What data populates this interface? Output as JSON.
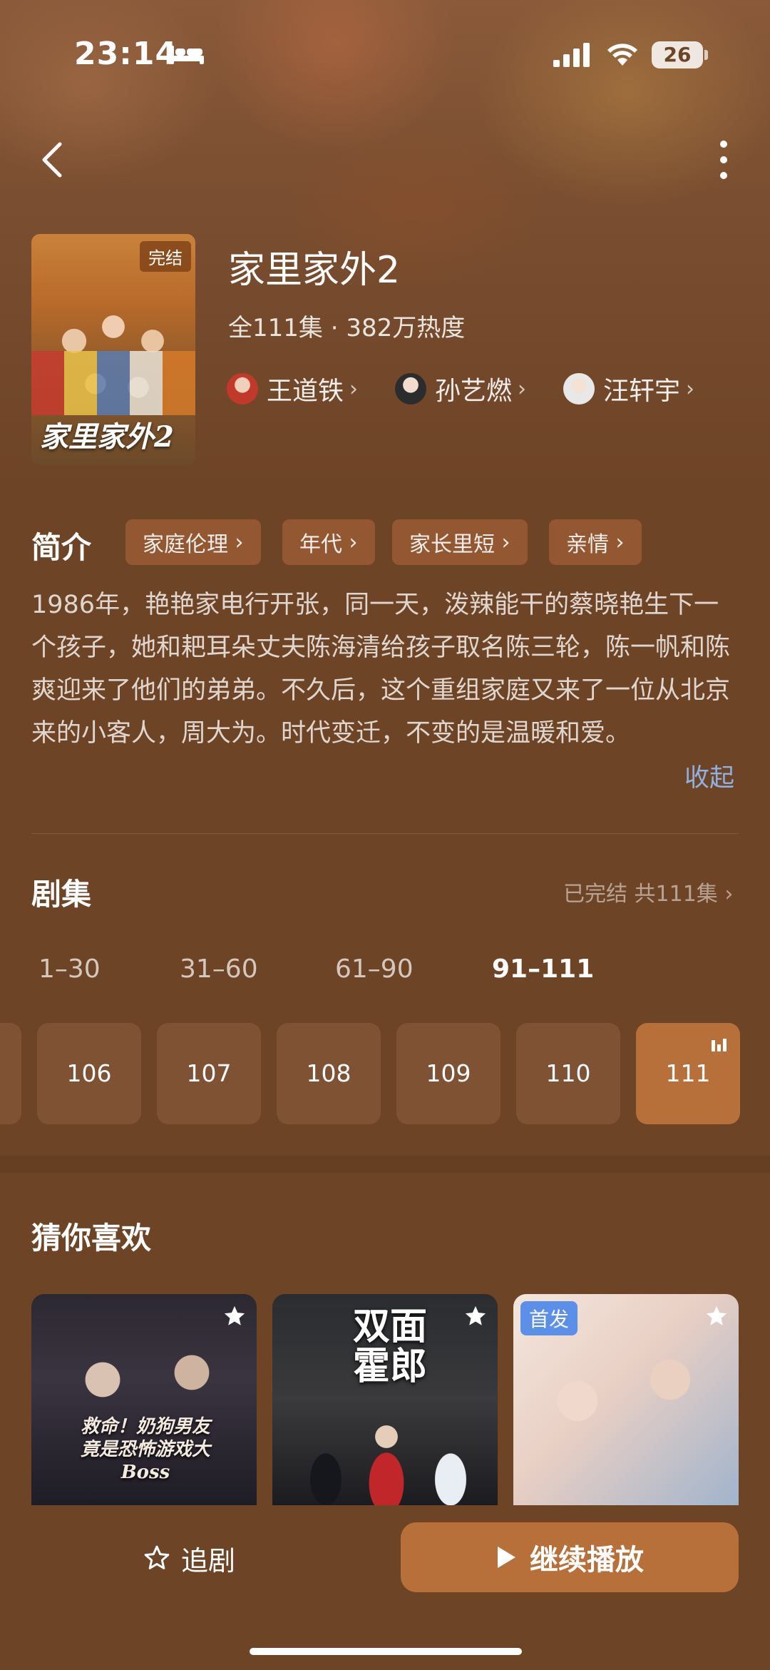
{
  "status": {
    "time": "23:14",
    "battery": "26"
  },
  "show": {
    "title": "家里家外2",
    "meta": "全111集 · 382万热度",
    "poster_badge": "完结",
    "poster_title": "家里家外2",
    "cast": [
      {
        "name": "王道铁",
        "avatar_color": "#c0392b"
      },
      {
        "name": "孙艺燃",
        "avatar_color": "#2c2c2c"
      },
      {
        "name": "汪轩宇",
        "avatar_color": "#e8e8e8"
      }
    ]
  },
  "intro": {
    "label": "简介",
    "tags": [
      "家庭伦理",
      "年代",
      "家长里短",
      "亲情"
    ],
    "synopsis": "1986年，艳艳家电行开张，同一天，泼辣能干的蔡晓艳生下一个孩子，她和耙耳朵丈夫陈海清给孩子取名陈三轮，陈一帆和陈爽迎来了他们的弟弟。不久后，这个重组家庭又来了一位从北京来的小客人，周大为。时代变迁，不变的是温暖和爱。",
    "collapse_label": "收起"
  },
  "episodes": {
    "label": "剧集",
    "summary": "已完结 共111集 ›",
    "ranges": [
      "1–30",
      "31–60",
      "61–90",
      "91–111"
    ],
    "active_range": 3,
    "items": [
      "106",
      "107",
      "108",
      "109",
      "110",
      "111"
    ],
    "playing": "111"
  },
  "recommend": {
    "label": "猜你喜欢",
    "cards": [
      {
        "title_text": "救命！奶狗男友竟是恐怖游戏大Boss"
      },
      {
        "title_text": "双面霍郎"
      },
      {
        "badge": "首发"
      }
    ]
  },
  "actions": {
    "follow_label": "追剧",
    "continue_label": "继续播放"
  },
  "colors": {
    "accent": "#b8703a",
    "background": "#6e4426",
    "link": "#8fb0e0"
  }
}
